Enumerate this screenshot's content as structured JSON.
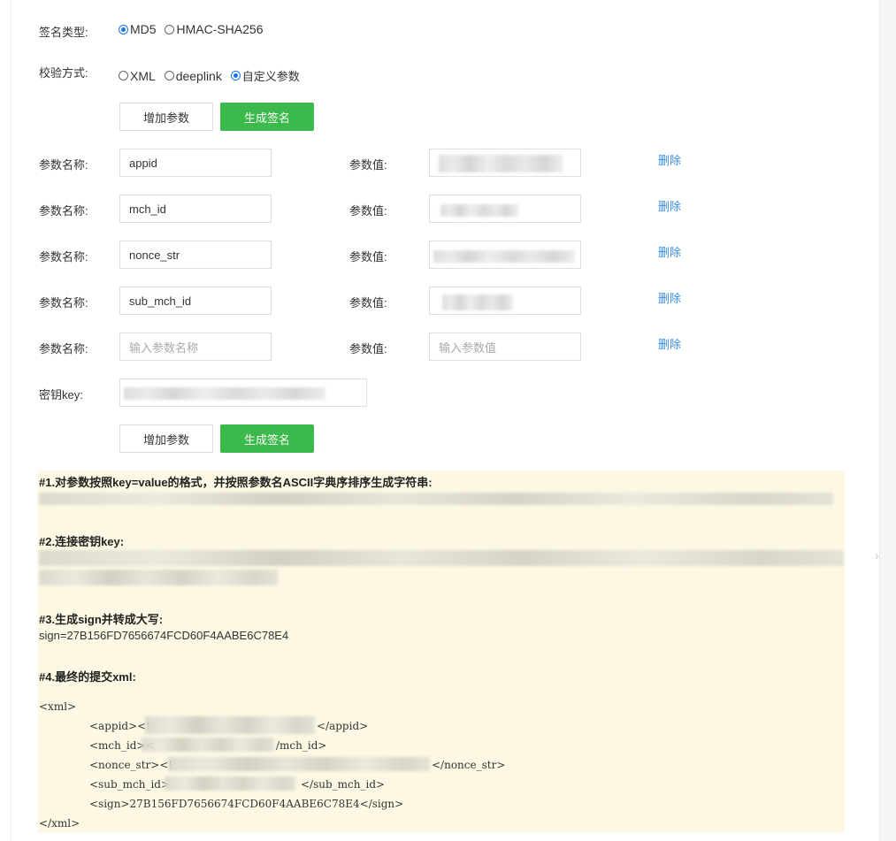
{
  "sign_type": {
    "label": "签名类型:",
    "options": [
      {
        "label": "MD5",
        "selected": true
      },
      {
        "label": "HMAC-SHA256",
        "selected": false
      }
    ]
  },
  "verify_mode": {
    "label": "校验方式:",
    "options": [
      {
        "label": "XML",
        "selected": false
      },
      {
        "label": "deeplink",
        "selected": false
      },
      {
        "label": "自定义参数",
        "selected": true
      }
    ]
  },
  "buttons": {
    "add_param": "增加参数",
    "gen_sign": "生成签名"
  },
  "params": {
    "name_label": "参数名称:",
    "value_label": "参数值:",
    "delete_label": "删除",
    "name_placeholder": "输入参数名称",
    "value_placeholder": "输入参数值",
    "rows": [
      {
        "name": "appid"
      },
      {
        "name": "mch_id"
      },
      {
        "name": "nonce_str"
      },
      {
        "name": "sub_mch_id"
      },
      {
        "name": ""
      }
    ]
  },
  "secret": {
    "label": "密钥key:"
  },
  "result": {
    "step1": "#1.对参数按照key=value的格式，并按照参数名ASCII字典序排序生成字符串:",
    "step2": "#2.连接密钥key:",
    "step3": "#3.生成sign并转成大写:",
    "sign_line": "sign=27B156FD7656674FCD60F4AABE6C78E4",
    "step4": "#4.最终的提交xml:",
    "xml_open": "<xml>",
    "appid_open": "<appid><!",
    "appid_close": "</appid>",
    "mchid_open": "<mch_id><",
    "mchid_close": "/mch_id>",
    "nonce_open": "<nonce_str><!",
    "nonce_close": "</nonce_str>",
    "submch_open": "<sub_mch_id>",
    "submch_close": "</sub_mch_id>",
    "sign_xml": "<sign>27B156FD7656674FCD60F4AABE6C78E4</sign>",
    "xml_close": "</xml>"
  }
}
